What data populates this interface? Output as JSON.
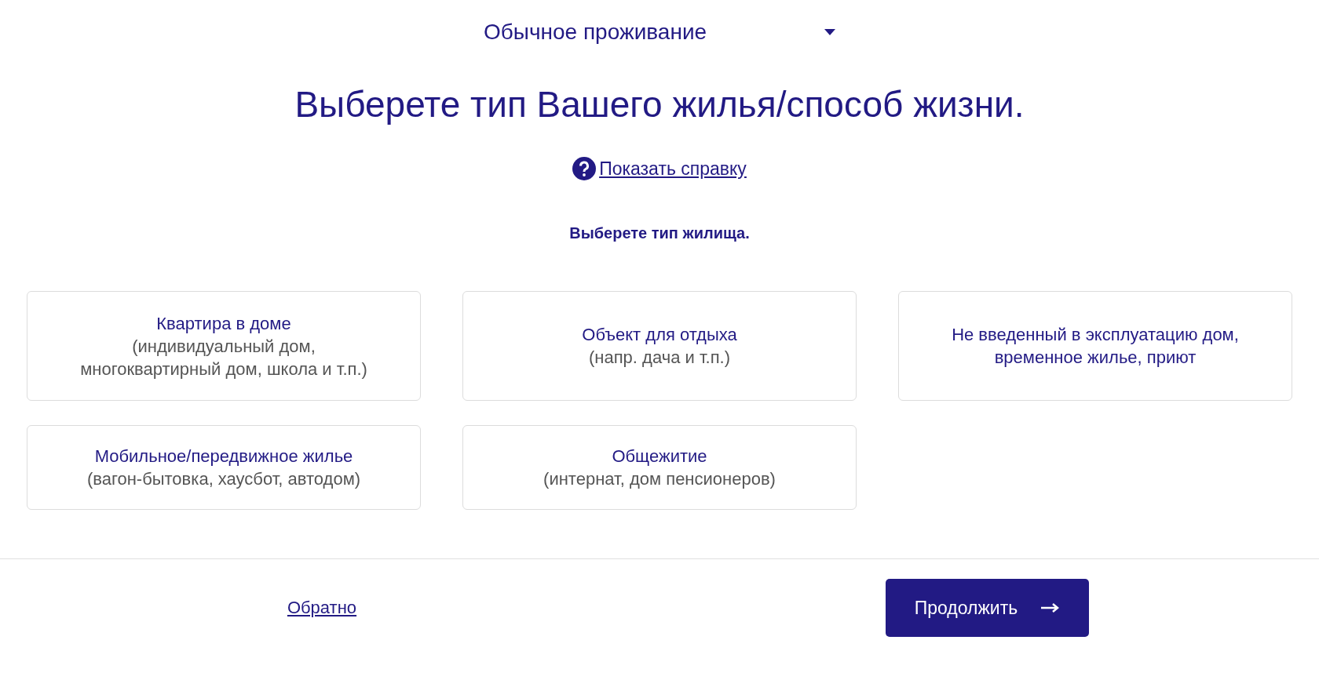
{
  "dropdown": {
    "value": "Обычное проживание"
  },
  "title": "Выберете тип Вашего жилья/способ жизни.",
  "help_link": "Показать справку",
  "subtitle": "Выберете тип жилища.",
  "options": [
    {
      "title": [
        "Квартира в доме"
      ],
      "description": [
        "(индивидуальный дом,",
        "многоквартирный дом, школа и т.п.)"
      ],
      "selected": false
    },
    {
      "title": [
        "Объект для отдыха"
      ],
      "description": [
        "(напр. дача и т.п.)"
      ],
      "selected": false
    },
    {
      "title": [
        "Не введенный в эксплуатацию дом,",
        "временное жилье, приют"
      ],
      "selected": false
    },
    {
      "title": [
        "Мобильное/передвижное жилье"
      ],
      "description": [
        "(вагон-бытовка, хаусбот, автодом)"
      ],
      "selected": false
    },
    {
      "title": [
        "Общежитие"
      ],
      "description": [
        "(интернат, дом пенсионеров)"
      ],
      "selected": false
    }
  ],
  "footer": {
    "back": "Обратно",
    "continue": "Продолжить"
  }
}
